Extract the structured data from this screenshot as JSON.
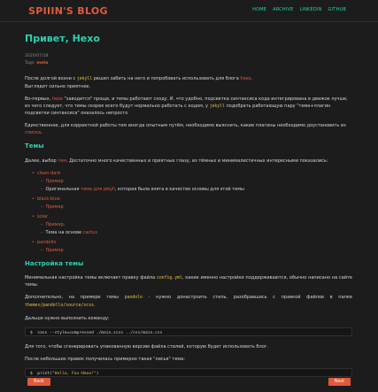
{
  "header": {
    "brand": "SPIIIN'S BLOG",
    "nav": [
      "HOME",
      "ARCHIVE",
      "LINKEDIN",
      "GITHUB"
    ]
  },
  "post": {
    "title": "Привет, Hexo",
    "date": "2020/07/18",
    "tags_label": "Tags:",
    "tag": "meta",
    "intro1": {
      "a": "После долгой возни с ",
      "code": "jekyll",
      "b": " решил забить на него и попробовать использовать для блога ",
      "hexo": "hexo",
      "c": "."
    },
    "intro2": "Выглядит сильно приятнее.",
    "intro3": {
      "a": "Во-первых, ",
      "hexo": "hexo",
      "b": " \"заводится\" проще, и темы работают сходу. И, что удобно, подсветка синтаксиса кода интегрирована в движок лучше, из чего следует, что темы скорее всего будут нормально работать с кодом, у ",
      "code": "jekyll",
      "c": " подобрать работающую пару \"тема+плагин подсветки синтаксиса\" оказалось непросто"
    },
    "intro4": {
      "a": "Единственное, для корректной работы тем иногда опытным путём, необходимо выяснить, какие плагины необходимо доустановить из ",
      "link": "списка",
      "b": "."
    },
    "themes_heading": "Темы",
    "themes_intro": {
      "a": "Далее, выбор ",
      "link": "тем",
      "b": ". Достаточно много качественных и приятных глазу, из тёмных и минималистичных интересными показались:"
    },
    "themes": [
      {
        "name": "clean-dark",
        "sub": [
          {
            "text": "",
            "link": "Пример",
            "after": ""
          },
          {
            "text": "Оригинальная ",
            "link": "тема для jekyll",
            "after": ", которая была взята в качестве основы для этой темы"
          }
        ]
      },
      {
        "name": "black-blue",
        "sub": [
          {
            "text": "",
            "link": "Пример",
            "after": ""
          }
        ]
      },
      {
        "name": "solar",
        "sub": [
          {
            "text": "",
            "link": "Пример",
            "after": "."
          },
          {
            "text": "Тема на основе ",
            "link": "cactus",
            "after": ""
          }
        ]
      },
      {
        "name": "pandollo",
        "sub": [
          {
            "text": "",
            "link": "Пример",
            "after": ""
          }
        ]
      }
    ],
    "settings_heading": "Настройка темы",
    "settings1": {
      "a": "Минимальная настройка темы включает правку файла ",
      "code": "config.yml",
      "b": ", какие именно настройки поддерживаются, обычно написано на сайте темы."
    },
    "settings2": {
      "a": "Дополнительно, на примере темы ",
      "code": "pandolo",
      "b": " - нужно донастроить стиль, разобравшись с правкой файлов в папке ",
      "path": "themes/pandollo/source/scss",
      "c": "."
    },
    "settings3": "Дальше нужно выполнить команду:",
    "cmd1": "$  sass --style=compressed ./main.scss ../css/main.css",
    "settings4": "Для того, чтобы сгенерировать упакованную версию файла стилей, которую будет использовать блог.",
    "settings5": "После небольших правок получилась примерно такая \"лисья\" тема:",
    "cmd2_pre": "$  print(",
    "cmd2_str": "\"Hello, Fox-Hexo!\"",
    "cmd2_post": ")"
  },
  "pager": {
    "back": "Back",
    "next": "Next"
  },
  "colors": {
    "background": "#1c1c1c",
    "accent_orange": "#e05a3a",
    "accent_teal": "#2bd1b0",
    "code_yellow": "#e7c547"
  }
}
